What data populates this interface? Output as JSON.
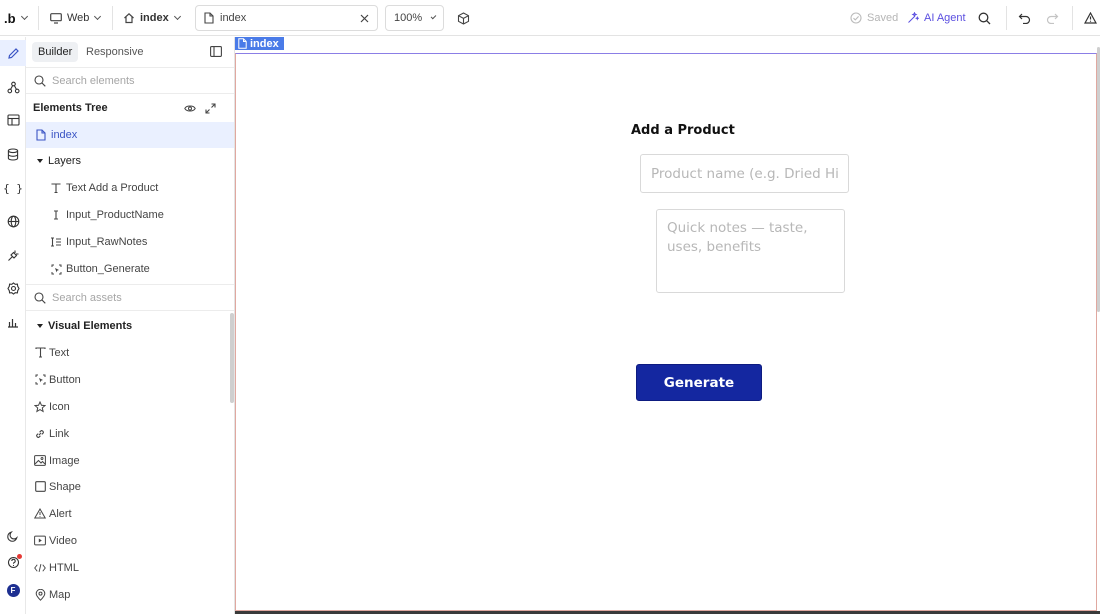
{
  "topbar": {
    "logo": ".b",
    "platform": "Web",
    "page": "index",
    "tab_title": "index",
    "zoom": "100%",
    "saved_label": "Saved",
    "ai_agent_label": "AI Agent",
    "icons": {
      "platform": "monitor-icon",
      "page": "home-icon",
      "tab": "file-icon",
      "close": "close-icon",
      "preview": "cube-icon",
      "saved": "check-circle-icon",
      "ai": "magic-wand-icon",
      "search": "search-icon",
      "undo": "undo-icon",
      "redo": "redo-icon",
      "alert": "warning-icon"
    }
  },
  "rail": {
    "items": [
      "pencil-icon",
      "components-icon",
      "layout-icon",
      "database-icon",
      "braces-icon",
      "globe-icon",
      "plug-icon",
      "settings-icon",
      "chart-icon"
    ],
    "bottom": [
      "moon-icon",
      "help-icon",
      "avatar"
    ],
    "avatar_letter": "F",
    "avatar_color": "#1d2f91",
    "notify_color": "#e53935"
  },
  "panel": {
    "tabs": [
      "Builder",
      "Responsive"
    ],
    "search_elements_placeholder": "Search elements",
    "elements_tree_title": "Elements Tree",
    "tree": {
      "root": "index",
      "layers_label": "Layers",
      "layers": [
        {
          "label": "Text Add a Product",
          "icon": "text-icon"
        },
        {
          "label": "Input_ProductName",
          "icon": "text-cursor-icon"
        },
        {
          "label": "Input_RawNotes",
          "icon": "textarea-icon"
        },
        {
          "label": "Button_Generate",
          "icon": "button-icon"
        }
      ]
    },
    "search_assets_placeholder": "Search assets",
    "visual_elements_title": "Visual Elements",
    "visual_elements": [
      {
        "label": "Text",
        "icon": "text-icon"
      },
      {
        "label": "Button",
        "icon": "button-icon"
      },
      {
        "label": "Icon",
        "icon": "star-icon"
      },
      {
        "label": "Link",
        "icon": "link-icon"
      },
      {
        "label": "Image",
        "icon": "image-icon"
      },
      {
        "label": "Shape",
        "icon": "square-icon"
      },
      {
        "label": "Alert",
        "icon": "warning-icon"
      },
      {
        "label": "Video",
        "icon": "video-icon"
      },
      {
        "label": "HTML",
        "icon": "code-icon"
      },
      {
        "label": "Map",
        "icon": "map-pin-icon"
      }
    ]
  },
  "canvas": {
    "frame_tag": "index",
    "title": "Add a Product",
    "product_name_placeholder": "Product name (e.g. Dried Hibiscus)",
    "notes_placeholder": "Quick notes — taste, uses, benefits",
    "button_label": "Generate",
    "button_color": "#1427a0",
    "accent_color": "#4a7be8"
  }
}
